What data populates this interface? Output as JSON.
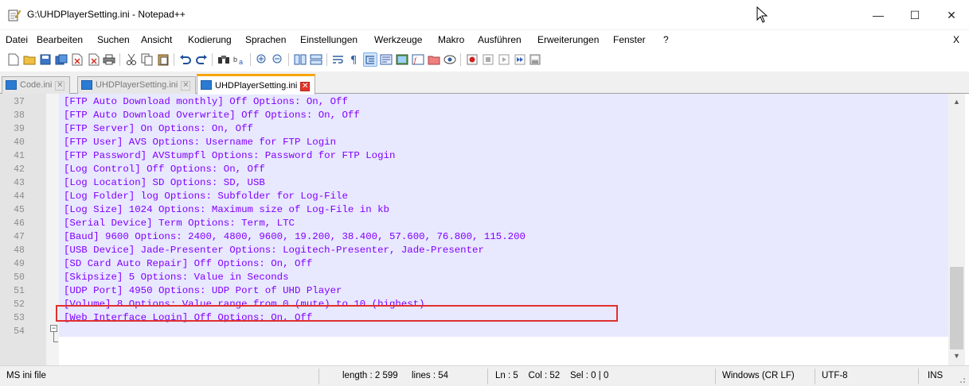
{
  "window": {
    "title": "G:\\UHDPlayerSetting.ini - Notepad++",
    "minimize_glyph": "—",
    "maximize_glyph": "☐",
    "close_glyph": "✕"
  },
  "menu": {
    "items": [
      "Datei",
      "Bearbeiten",
      "Suchen",
      "Ansicht",
      "Kodierung",
      "Sprachen",
      "Einstellungen",
      "Werkzeuge",
      "Makro",
      "Ausführen",
      "Erweiterungen",
      "Fenster",
      "?"
    ],
    "close_label": "X"
  },
  "toolbar": {
    "buttons": [
      "new-icon",
      "open-icon",
      "save-icon",
      "save-all-icon",
      "close-icon",
      "close-all-icon",
      "print-icon",
      "cut-icon",
      "copy-icon",
      "paste-icon",
      "undo-icon",
      "redo-icon",
      "find-icon",
      "replace-icon",
      "zoom-in-icon",
      "zoom-out-icon",
      "sync-vertical-icon",
      "sync-horizontal-icon",
      "word-wrap-icon",
      "show-all-chars-icon",
      "indent-guide-icon",
      "lang-define-icon",
      "doc-map-icon",
      "function-list-icon",
      "folder-workspace-icon",
      "monitor-icon",
      "record-macro-icon",
      "stop-macro-icon",
      "play-macro-icon",
      "run-macro-multiple-icon",
      "save-macro-icon"
    ]
  },
  "tabs": [
    {
      "label": "Code.ini",
      "close": "✕",
      "active": false
    },
    {
      "label": "UHDPlayerSetting.ini",
      "close": "✕",
      "active": false
    },
    {
      "label": "UHDPlayerSetting.ini",
      "close": "✕",
      "active": true
    }
  ],
  "editor": {
    "lines": [
      {
        "num": "37",
        "text": "[FTP Auto Download monthly] Off Options: On, Off"
      },
      {
        "num": "38",
        "text": "[FTP Auto Download Overwrite] Off Options: On, Off"
      },
      {
        "num": "39",
        "text": "[FTP Server] On Options: On, Off"
      },
      {
        "num": "40",
        "text": "[FTP User] AVS Options: Username for FTP Login"
      },
      {
        "num": "41",
        "text": "[FTP Password] AVStumpfl Options: Password for FTP Login"
      },
      {
        "num": "42",
        "text": "[Log Control] Off Options: On, Off"
      },
      {
        "num": "43",
        "text": "[Log Location] SD Options: SD, USB"
      },
      {
        "num": "44",
        "text": "[Log Folder] log Options: Subfolder for Log-File"
      },
      {
        "num": "45",
        "text": "[Log Size] 1024 Options: Maximum size of Log-File in kb"
      },
      {
        "num": "46",
        "text": "[Serial Device] Term Options: Term, LTC"
      },
      {
        "num": "47",
        "text": "[Baud] 9600 Options: 2400, 4800, 9600, 19.200, 38.400, 57.600, 76.800, 115.200"
      },
      {
        "num": "48",
        "text": "[USB Device] Jade-Presenter Options: Logitech-Presenter, Jade-Presenter"
      },
      {
        "num": "49",
        "text": "[SD Card Auto Repair] Off Options: On, Off"
      },
      {
        "num": "50",
        "text": "[Skipsize] 5 Options: Value in Seconds"
      },
      {
        "num": "51",
        "text": "[UDP Port] 4950 Options: UDP Port of UHD Player"
      },
      {
        "num": "52",
        "text": "[Volume] 8 Options: Value range from 0 (mute) to 10 (highest)"
      },
      {
        "num": "53",
        "text": "[Web Interface Login] Off Options: On, Off"
      },
      {
        "num": "54",
        "text": ""
      }
    ],
    "fold_glyph": "−",
    "scroll_up_glyph": "▲",
    "scroll_down_glyph": "▼"
  },
  "statusbar": {
    "file_type": "MS ini file",
    "length": "length : 2 599",
    "lines": "lines : 54",
    "position": "Ln : 5    Col : 52    Sel : 0 | 0",
    "eol": "Windows (CR LF)",
    "encoding": "UTF-8",
    "mode": "INS"
  },
  "colors": {
    "accent_tab": "#f7a600",
    "code_text": "#8000ff",
    "line_number": "#8c8c8c",
    "highlight_border": "#e03030",
    "line_bg": "#e8e8ff"
  }
}
